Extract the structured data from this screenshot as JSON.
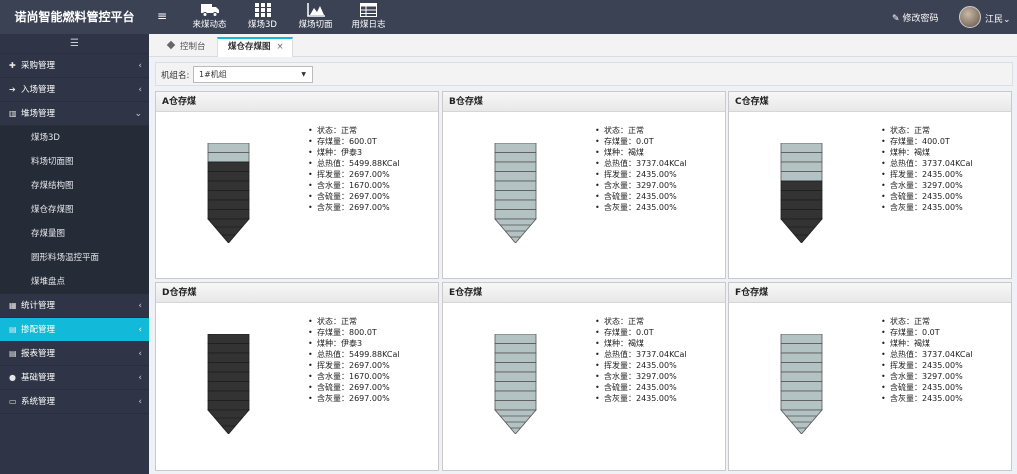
{
  "app": {
    "title": "诺尚智能燃料管控平台"
  },
  "header": {
    "nav": [
      {
        "label": "来煤动态",
        "icon": "truck-icon"
      },
      {
        "label": "煤场3D",
        "icon": "grid-icon"
      },
      {
        "label": "煤场切面",
        "icon": "area-chart-icon"
      },
      {
        "label": "用煤日志",
        "icon": "table-icon"
      }
    ],
    "change_password": "修改密码",
    "user": "江民"
  },
  "sidebar": {
    "items": [
      {
        "label": "采购管理",
        "icon": "plus-icon"
      },
      {
        "label": "入场管理",
        "icon": "sign-in-icon"
      },
      {
        "label": "堆场管理",
        "icon": "bar-chart-icon",
        "expanded": true,
        "children": [
          "煤场3D",
          "料场切面图",
          "存煤结构图",
          "煤仓存煤图",
          "存煤量图",
          "圆形料场温控平面",
          "煤堆盘点"
        ]
      },
      {
        "label": "统计管理",
        "icon": "th-icon"
      },
      {
        "label": "掺配管理",
        "icon": "edit-icon",
        "active": true
      },
      {
        "label": "报表管理",
        "icon": "list-icon"
      },
      {
        "label": "基础管理",
        "icon": "globe-icon"
      },
      {
        "label": "系统管理",
        "icon": "desktop-icon"
      }
    ]
  },
  "tabs": [
    {
      "label": "控制台"
    },
    {
      "label": "煤仓存煤图",
      "active": true,
      "close": "×"
    }
  ],
  "filter": {
    "label": "机组名:",
    "value": "1#机组"
  },
  "info_labels": [
    "状态：",
    "存煤量：",
    "煤种：",
    "总热值：",
    "挥发量：",
    "含水量：",
    "含硫量：",
    "含灰量："
  ],
  "colors": {
    "coal_filled": "#333333",
    "coal_empty": "#b3c2c2",
    "accent": "#13b9d8",
    "sidebar": "#2f3546",
    "topbar": "#3b4254"
  },
  "bins": [
    {
      "title": "A仓存煤",
      "status": "正常",
      "stock": "600.0T",
      "coal_type": "伊泰3",
      "heat": "5499.88KCal",
      "volatile": "2697.00%",
      "moisture": "1670.00%",
      "sulfur": "2697.00%",
      "ash": "2697.00%",
      "fill_fraction": 0.7
    },
    {
      "title": "B仓存煤",
      "status": "正常",
      "stock": "0.0T",
      "coal_type": "褐煤",
      "heat": "3737.04KCal",
      "volatile": "2435.00%",
      "moisture": "3297.00%",
      "sulfur": "2435.00%",
      "ash": "2435.00%",
      "fill_fraction": 0
    },
    {
      "title": "C仓存煤",
      "status": "正常",
      "stock": "400.0T",
      "coal_type": "褐煤",
      "heat": "3737.04KCal",
      "volatile": "2435.00%",
      "moisture": "3297.00%",
      "sulfur": "2435.00%",
      "ash": "2435.00%",
      "fill_fraction": 0.5
    },
    {
      "title": "D仓存煤",
      "status": "正常",
      "stock": "800.0T",
      "coal_type": "伊泰3",
      "heat": "5499.88KCal",
      "volatile": "2697.00%",
      "moisture": "1670.00%",
      "sulfur": "2697.00%",
      "ash": "2697.00%",
      "fill_fraction": 1
    },
    {
      "title": "E仓存煤",
      "status": "正常",
      "stock": "0.0T",
      "coal_type": "褐煤",
      "heat": "3737.04KCal",
      "volatile": "2435.00%",
      "moisture": "3297.00%",
      "sulfur": "2435.00%",
      "ash": "2435.00%",
      "fill_fraction": 0
    },
    {
      "title": "F仓存煤",
      "status": "正常",
      "stock": "0.0T",
      "coal_type": "褐煤",
      "heat": "3737.04KCal",
      "volatile": "2435.00%",
      "moisture": "3297.00%",
      "sulfur": "2435.00%",
      "ash": "2435.00%",
      "fill_fraction": 0
    }
  ]
}
